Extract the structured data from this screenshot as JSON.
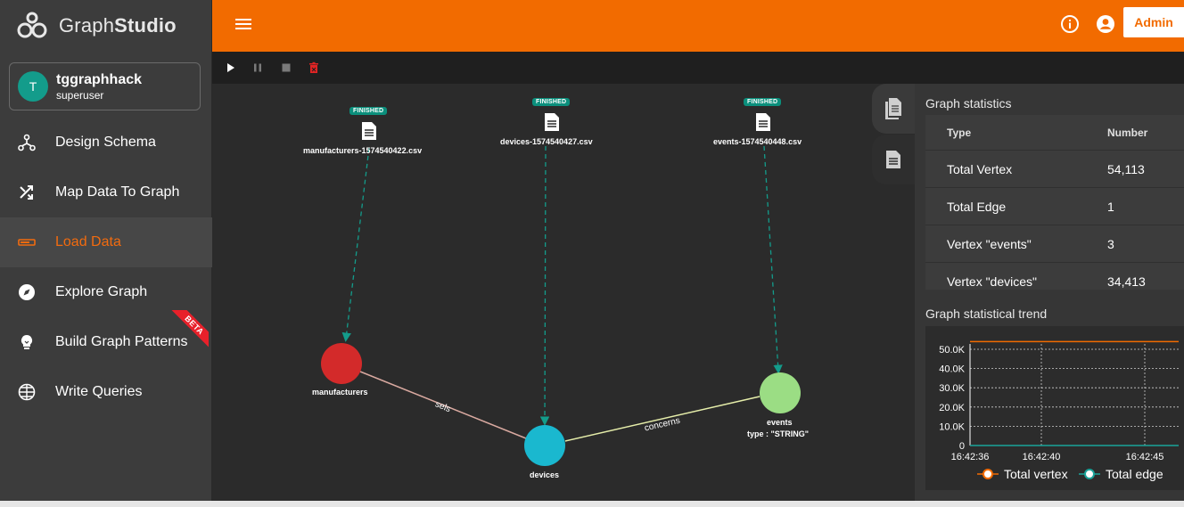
{
  "app": {
    "logo_text_a": "Graph",
    "logo_text_b": "Studio"
  },
  "user": {
    "initial": "T",
    "name": "tggraphhack",
    "role": "superuser"
  },
  "nav": [
    {
      "label": "Design Schema",
      "icon": "schema-icon",
      "active": false
    },
    {
      "label": "Map Data To Graph",
      "icon": "shuffle-icon",
      "active": false
    },
    {
      "label": "Load Data",
      "icon": "load-icon",
      "active": true
    },
    {
      "label": "Explore Graph",
      "icon": "compass-icon",
      "active": false
    },
    {
      "label": "Build Graph Patterns",
      "icon": "bulb-icon",
      "active": false,
      "badge": "BETA"
    },
    {
      "label": "Write Queries",
      "icon": "globe-icon",
      "active": false
    }
  ],
  "topbar": {
    "admin_label": "Admin"
  },
  "graph": {
    "files": [
      {
        "name": "manufacturers-1574540422.csv",
        "status": "FINISHED"
      },
      {
        "name": "devices-1574540427.csv",
        "status": "FINISHED"
      },
      {
        "name": "events-1574540448.csv",
        "status": "FINISHED"
      }
    ],
    "vertices": [
      {
        "name": "manufacturers",
        "color": "#d32a2a"
      },
      {
        "name": "devices",
        "color": "#1ab8cf"
      },
      {
        "name": "events",
        "subtitle": "type : \"STRING\"",
        "color": "#9bdd84"
      }
    ],
    "edges": [
      {
        "name": "sels",
        "color": "#d9a9a0"
      },
      {
        "name": "concerns",
        "color": "#e6eeaa"
      }
    ]
  },
  "stats": {
    "title": "Graph statistics",
    "header": {
      "type": "Type",
      "number": "Number"
    },
    "rows": [
      {
        "type": "Total Vertex",
        "number": "54,113"
      },
      {
        "type": "Total Edge",
        "number": "1"
      },
      {
        "type": "Vertex \"events\"",
        "number": "3"
      },
      {
        "type": "Vertex \"devices\"",
        "number": "34,413"
      }
    ]
  },
  "trend": {
    "title": "Graph statistical trend",
    "legend": {
      "vertex": "Total vertex",
      "edge": "Total edge"
    }
  },
  "chart_data": {
    "type": "line",
    "x": [
      "16:42:36",
      "16:42:40",
      "16:42:45"
    ],
    "ylim": [
      0,
      50000
    ],
    "yticks": [
      "50.0K",
      "40.0K",
      "30.0K",
      "20.0K",
      "10.0K",
      "0"
    ],
    "series": [
      {
        "name": "Total vertex",
        "color": "#f26b00",
        "values": [
          54113,
          54113,
          54113
        ]
      },
      {
        "name": "Total edge",
        "color": "#1aa39a",
        "values": [
          1,
          1,
          1
        ]
      }
    ],
    "grid": true,
    "legend": "bottom"
  },
  "colors": {
    "accent": "#f26b00",
    "teal": "#0b8f7c"
  }
}
